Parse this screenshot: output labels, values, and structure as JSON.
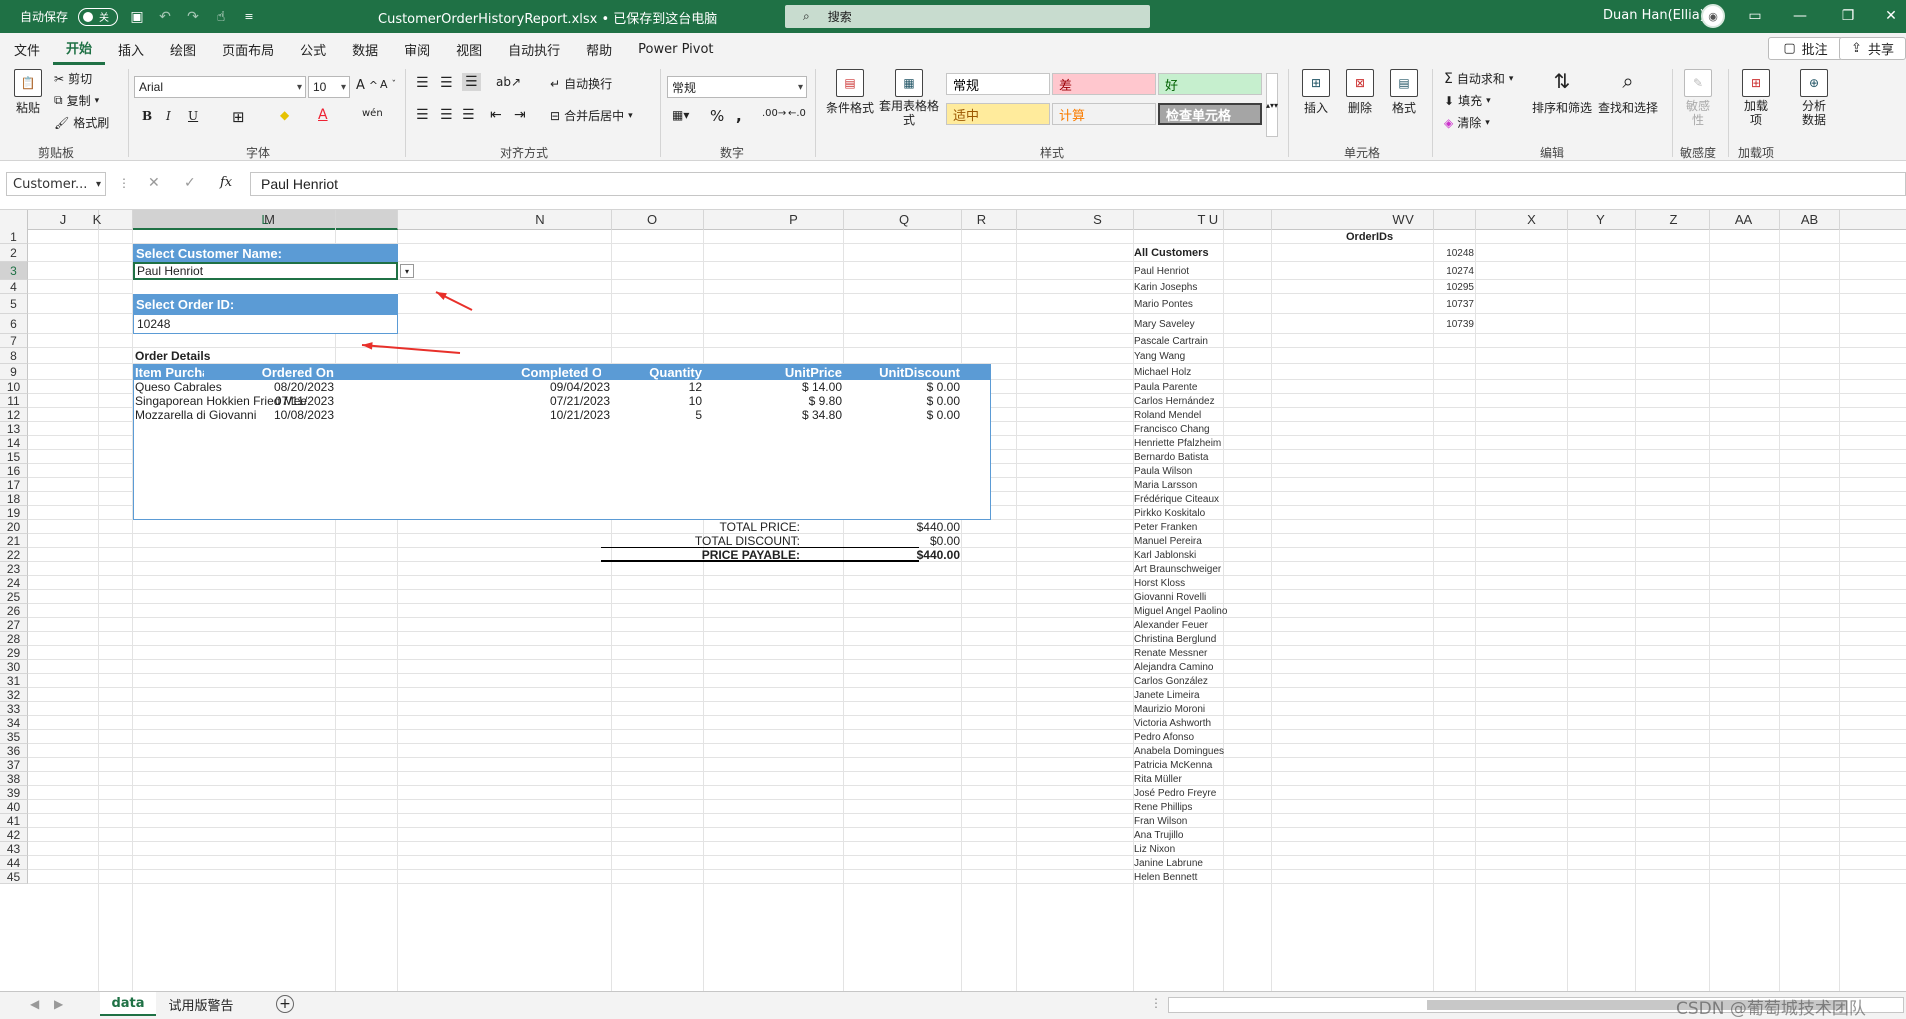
{
  "titlebar": {
    "autosave_label": "自动保存",
    "autosave_state": "关",
    "doc_title": "CustomerOrderHistoryReport.xlsx • 已保存到这台电脑",
    "search_placeholder": "搜索",
    "user_name": "Duan Han(Ellia)"
  },
  "menu": {
    "tabs": [
      "文件",
      "开始",
      "插入",
      "绘图",
      "页面布局",
      "公式",
      "数据",
      "审阅",
      "视图",
      "自动执行",
      "帮助",
      "Power Pivot"
    ],
    "active": "开始",
    "comment_label": "批注",
    "share_label": "共享"
  },
  "ribbon": {
    "clipboard": {
      "paste": "粘贴",
      "cut": "剪切",
      "copy": "复制",
      "format_painter": "格式刷",
      "label": "剪贴板"
    },
    "font": {
      "name": "Arial",
      "size": "10",
      "label": "字体"
    },
    "alignment": {
      "wrap": "自动换行",
      "merge": "合并后居中",
      "label": "对齐方式"
    },
    "number": {
      "format": "常规",
      "label": "数字"
    },
    "styles": {
      "conditional": "条件格式",
      "table": "套用表格格式",
      "cells": [
        {
          "text": "常规",
          "bg": "#ffffff",
          "fg": "#000000"
        },
        {
          "text": "差",
          "bg": "#ffc7ce",
          "fg": "#9c0006"
        },
        {
          "text": "好",
          "bg": "#c6efce",
          "fg": "#006100"
        },
        {
          "text": "适中",
          "bg": "#ffeb9c",
          "fg": "#9c5700"
        },
        {
          "text": "计算",
          "bg": "#f2f2f2",
          "fg": "#fa7d00"
        },
        {
          "text": "检查单元格",
          "bg": "#a5a5a5",
          "fg": "#ffffff"
        }
      ],
      "label": "样式"
    },
    "cells_group": {
      "insert": "插入",
      "delete": "删除",
      "format": "格式",
      "label": "单元格"
    },
    "editing": {
      "autosum": "自动求和",
      "fill": "填充",
      "clear": "清除",
      "sort": "排序和筛选",
      "find": "查找和选择",
      "label": "编辑"
    },
    "sensitivity": {
      "btn": "敏感性",
      "label": "敏感度"
    },
    "addins": {
      "btn": "加载项",
      "label": "加载项"
    },
    "analyze": {
      "btn": "分析数据"
    }
  },
  "formula_bar": {
    "name_box": "Customer...",
    "fx": "fx",
    "value": "Paul Henriot"
  },
  "columns": [
    "J",
    "K",
    "L",
    "M",
    "N",
    "O",
    "P",
    "Q",
    "R",
    "S",
    "T",
    "U",
    "V",
    "W",
    "X",
    "Y",
    "Z",
    "AA",
    "AB"
  ],
  "selected_column": "L",
  "selected_row": "3",
  "rows": [
    "1",
    "2",
    "3",
    "4",
    "5",
    "6",
    "7",
    "8",
    "9",
    "10",
    "11",
    "12",
    "13",
    "14",
    "15",
    "16",
    "17",
    "18",
    "19",
    "20",
    "21",
    "22",
    "23",
    "24",
    "25",
    "26",
    "27",
    "28",
    "29",
    "30",
    "31",
    "32",
    "33",
    "34",
    "35",
    "36",
    "37",
    "38",
    "39",
    "40",
    "41",
    "42",
    "43",
    "44",
    "45"
  ],
  "report": {
    "customer_label": "Select Customer Name:",
    "customer_value": "Paul Henriot",
    "order_label": "Select Order ID:",
    "order_value": "10248",
    "details_title": "Order Details",
    "headers": [
      "Item Purchased",
      "Ordered On",
      "Completed On",
      "Quantity",
      "UnitPrice",
      "UnitDiscount"
    ],
    "items": [
      [
        "Queso Cabrales",
        "08/20/2023",
        "09/04/2023",
        "12",
        "$ 14.00",
        "$ 0.00"
      ],
      [
        "Singaporean Hokkien Fried Mee",
        "07/11/2023",
        "07/21/2023",
        "10",
        "$ 9.80",
        "$ 0.00"
      ],
      [
        "Mozzarella di Giovanni",
        "10/08/2023",
        "10/21/2023",
        "5",
        "$ 34.80",
        "$ 0.00"
      ]
    ],
    "totals": [
      {
        "label": "TOTAL PRICE:",
        "value": "$440.00"
      },
      {
        "label": "TOTAL DISCOUNT:",
        "value": "$0.00"
      },
      {
        "label": "PRICE PAYABLE:",
        "value": "$440.00"
      }
    ]
  },
  "side_list": {
    "orderids_header": "OrderIDs",
    "all_customers": "All Customers",
    "customers": [
      "Paul Henriot",
      "Karin Josephs",
      "Mario Pontes",
      "Mary Saveley",
      "Pascale Cartrain",
      "Yang Wang",
      "Michael Holz",
      "Paula Parente",
      "Carlos Hernández",
      "Roland Mendel",
      "Francisco Chang",
      "Henriette Pfalzheim",
      "Bernardo Batista",
      "Paula Wilson",
      "Maria Larsson",
      "Frédérique Citeaux",
      "Pirkko Koskitalo",
      "Peter Franken",
      "Manuel Pereira",
      "Karl Jablonski",
      "Art Braunschweiger",
      "Horst Kloss",
      "Giovanni Rovelli",
      "Miguel Angel Paolino",
      "Alexander Feuer",
      "Christina Berglund",
      "Renate Messner",
      "Alejandra Camino",
      "Carlos González",
      "Janete Limeira",
      "Maurizio Moroni",
      "Victoria Ashworth",
      "Pedro Afonso",
      "Anabela Domingues",
      "Patricia McKenna",
      "Rita Müller",
      "José Pedro Freyre",
      "Rene Phillips",
      "Fran Wilson",
      "Ana Trujillo",
      "Liz Nixon",
      "Janine Labrune",
      "Helen Bennett"
    ],
    "order_ids": [
      "10248",
      "10274",
      "10295",
      "10737",
      "10739"
    ]
  },
  "sheets": {
    "tabs": [
      "data",
      "试用版警告"
    ],
    "active": "data"
  },
  "watermark": "CSDN @葡萄城技术团队",
  "colors": {
    "excel_green": "#1f7145",
    "header_blue": "#5b9bd5",
    "arrow_red": "#e8302a"
  }
}
